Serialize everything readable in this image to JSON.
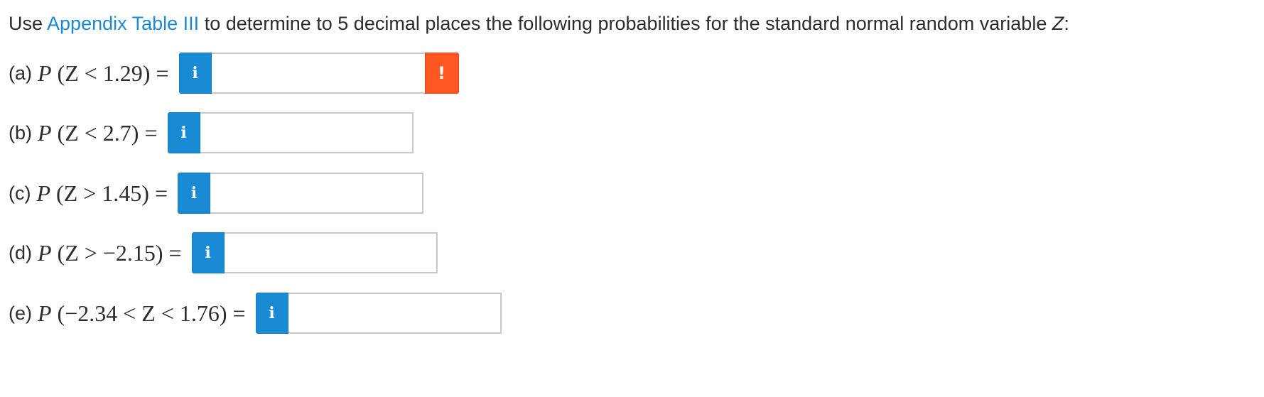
{
  "instructions": {
    "prefix": "Use ",
    "link_text": "Appendix Table III",
    "middle": " to determine to 5 decimal places the following probabilities for the standard normal random variable ",
    "variable": "Z",
    "suffix": ":"
  },
  "icons": {
    "info": "info-icon",
    "alert": "exclamation-icon"
  },
  "colors": {
    "link": "#1a8ad4",
    "info_button": "#1a8ad4",
    "alert_button": "#ff5722",
    "input_border": "#c9c9c9",
    "text": "#2d2d2d"
  },
  "questions": [
    {
      "label": "(a)",
      "expr_pre": "P",
      "expr_body": " (Z < 1.29) =",
      "value": "",
      "info_glyph": "i",
      "alert_glyph": "!"
    },
    {
      "label": "(b)",
      "expr_pre": "P",
      "expr_body": " (Z < 2.7) =",
      "value": "",
      "info_glyph": "i"
    },
    {
      "label": "(c)",
      "expr_pre": "P",
      "expr_body": " (Z > 1.45) =",
      "value": "",
      "info_glyph": "i"
    },
    {
      "label": "(d)",
      "expr_pre": "P",
      "expr_body": " (Z > −2.15) =",
      "value": "",
      "info_glyph": "i"
    },
    {
      "label": "(e)",
      "expr_pre": "P",
      "expr_body": " (−2.34 < Z < 1.76) =",
      "value": "",
      "info_glyph": "i"
    }
  ]
}
